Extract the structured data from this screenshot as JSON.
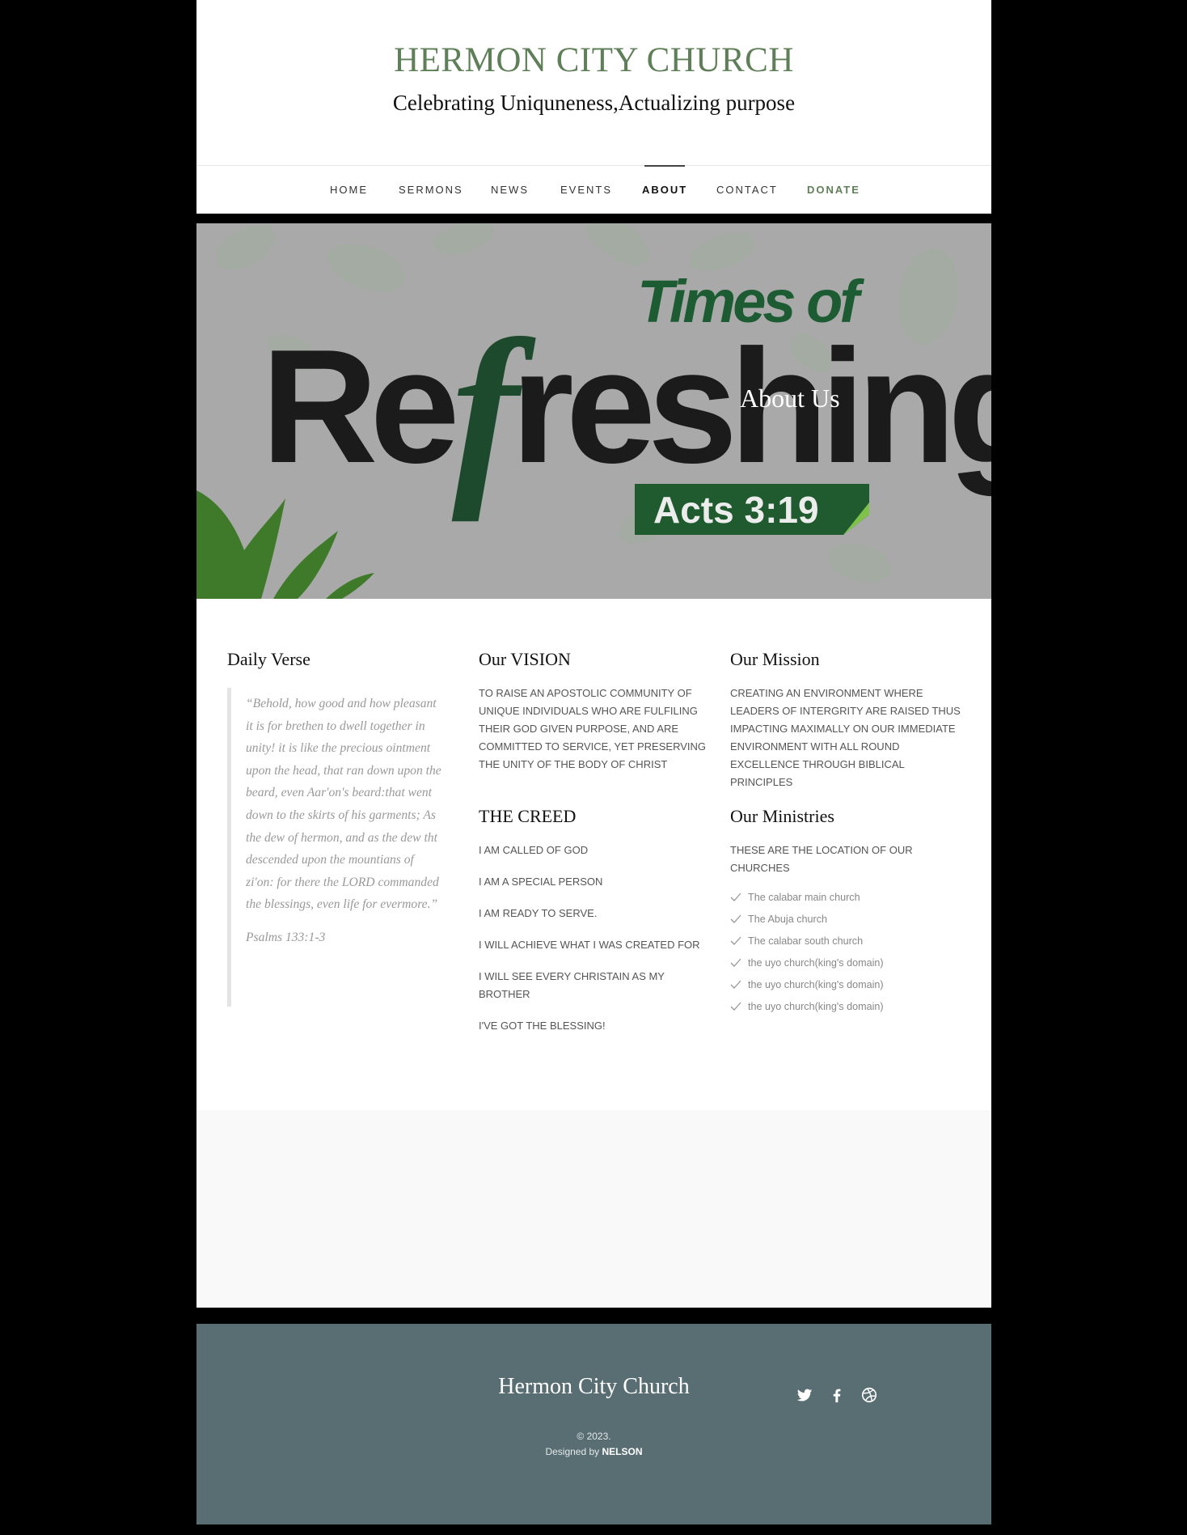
{
  "header": {
    "title": "HERMON CITY CHURCH",
    "tagline": "Celebrating Uniquneness,Actualizing purpose"
  },
  "nav": {
    "items": [
      "HOME",
      "SERMONS",
      "NEWS",
      "EVENTS",
      "ABOUT",
      "CONTACT",
      "DONATE"
    ],
    "active": "ABOUT"
  },
  "hero": {
    "banner_line1": "Times of",
    "banner_line2_a": "Re",
    "banner_line2_f": "f",
    "banner_line2_b": "reshing",
    "banner_ref": "Acts 3:19",
    "page_title": "About Us"
  },
  "daily_verse": {
    "heading": "Daily Verse",
    "quote": "“Behold, how good and how pleasant it is for brethen to dwell together in unity! it is like the precious ointment upon the head, that ran down upon the beard, even Aar'on's beard:that went down to the skirts of his garments; As the dew of hermon, and as the dew tht descended upon the mountians of zi'on: for there the LORD commanded the blessings, even life for evermore.”",
    "citation": "Psalms 133:1-3"
  },
  "vision": {
    "heading": "Our VISION",
    "text": "TO RAISE AN APOSTOLIC COMMUNITY OF UNIQUE INDIVIDUALS WHO ARE FULFILING THEIR GOD GIVEN PURPOSE, AND ARE COMMITTED TO SERVICE, YET PRESERVING THE UNITY OF THE BODY OF CHRIST"
  },
  "creed": {
    "heading": "THE CREED",
    "items": [
      "I AM CALLED OF GOD",
      "I AM A SPECIAL PERSON",
      "I AM READY TO SERVE.",
      "I WILL ACHIEVE WHAT I WAS CREATED FOR",
      "I WILL SEE EVERY CHRISTAIN AS MY BROTHER",
      "I'VE GOT THE BLESSING!"
    ]
  },
  "mission": {
    "heading": "Our Mission",
    "text": "CREATING AN ENVIRONMENT WHERE LEADERS OF INTERGRITY ARE RAISED THUS IMPACTING MAXIMALLY ON OUR IMMEDIATE ENVIRONMENT WITH ALL ROUND EXCELLENCE THROUGH BIBLICAL PRINCIPLES"
  },
  "ministries": {
    "heading": "Our Ministries",
    "intro": "THESE ARE THE LOCATION OF OUR CHURCHES",
    "items": [
      "The calabar main church",
      "The Abuja church",
      "The calabar south church",
      "the uyo church(king's domain)",
      "the uyo church(king's domain)",
      "the uyo church(king's domain)"
    ]
  },
  "footer": {
    "title": "Hermon City Church",
    "copyright": "© 2023.",
    "designed_by": "Designed by",
    "designer": "NELSON",
    "social_icons": [
      "twitter-icon",
      "facebook-icon",
      "dribbble-icon"
    ]
  },
  "colors": {
    "brand_green": "#5f7f58",
    "footer_bg": "#596e73",
    "dark_green": "#1d4a2c"
  }
}
